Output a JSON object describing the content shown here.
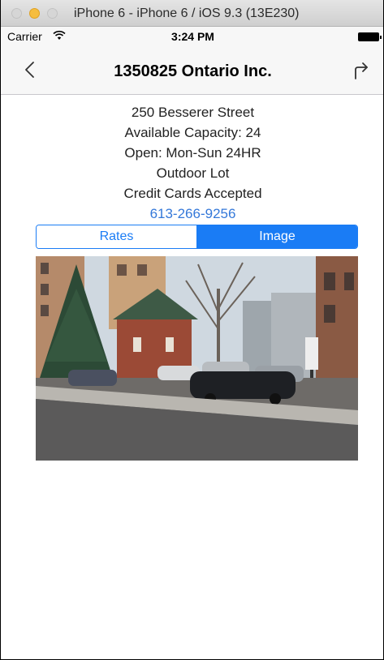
{
  "simulator": {
    "title": "iPhone 6 - iPhone 6 / iOS 9.3 (13E230)"
  },
  "status_bar": {
    "carrier": "Carrier",
    "time": "3:24 PM"
  },
  "nav": {
    "title": "1350825 Ontario Inc.",
    "back_icon": "chevron-left-icon",
    "share_icon": "share-arrow-icon"
  },
  "details": {
    "address": "250 Besserer Street",
    "capacity": "Available Capacity: 24",
    "hours": "Open: Mon-Sun 24HR",
    "lot_type": "Outdoor Lot",
    "payment": "Credit Cards Accepted",
    "phone": "613-266-9256"
  },
  "segments": {
    "rates": "Rates",
    "image": "Image",
    "selected": "Image"
  },
  "colors": {
    "accent": "#1a7cf5",
    "link": "#3478d9"
  }
}
